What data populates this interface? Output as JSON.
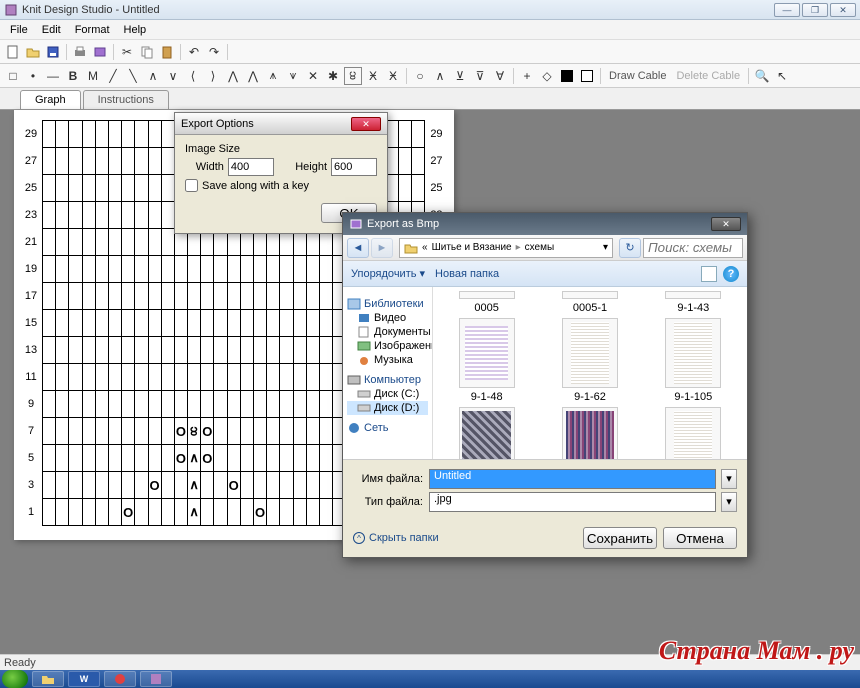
{
  "app": {
    "title": "Knit Design Studio - Untitled"
  },
  "menu": {
    "file": "File",
    "edit": "Edit",
    "format": "Format",
    "help": "Help"
  },
  "toolbar2": {
    "draw": "Draw Cable",
    "delete": "Delete Cable"
  },
  "tabs": {
    "graph": "Graph",
    "instructions": "Instructions"
  },
  "row_labels": [
    "29",
    "27",
    "25",
    "23",
    "21",
    "19",
    "17",
    "15",
    "13",
    "11",
    "9",
    "7",
    "5",
    "3",
    "1"
  ],
  "export_dlg": {
    "title": "Export Options",
    "image_size": "Image Size",
    "width_label": "Width",
    "width_value": "400",
    "height_label": "Height",
    "height_value": "600",
    "save_key": "Save along with a key",
    "ok": "OK"
  },
  "save_dlg": {
    "title": "Export as Bmp",
    "crumb1": "Шитье и Вязание",
    "crumb2": "схемы",
    "search_ph": "Поиск: схемы",
    "organize": "Упорядочить",
    "new_folder": "Новая папка",
    "tree": {
      "libraries": "Библиотеки",
      "video": "Видео",
      "documents": "Документы",
      "images": "Изображения",
      "music": "Музыка",
      "computer": "Компьютер",
      "disk_c": "Диск (C:)",
      "disk_d": "Диск (D:)",
      "network": "Сеть"
    },
    "files": [
      "0005",
      "0005-1",
      "9-1-43",
      "9-1-48",
      "9-1-62",
      "9-1-105"
    ],
    "filename_label": "Имя файла:",
    "filename_value": "Untitled",
    "filetype_label": "Тип файла:",
    "filetype_value": ".jpg",
    "hide_folders": "Скрыть папки",
    "save": "Сохранить",
    "cancel": "Отмена"
  },
  "status": "Ready",
  "watermark": "Страна Мам . ру"
}
